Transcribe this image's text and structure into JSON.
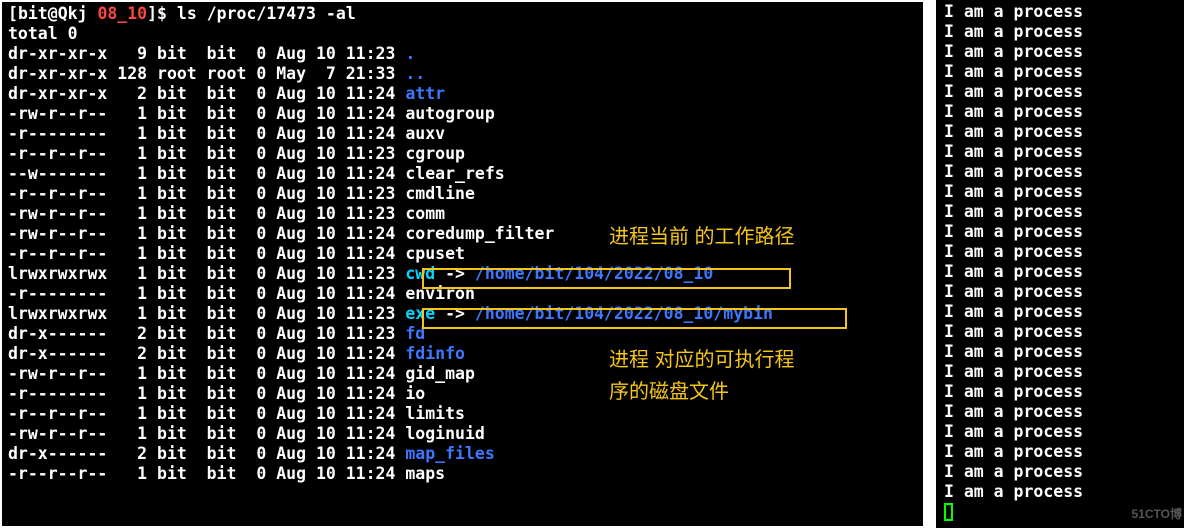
{
  "prompt": {
    "user": "bit",
    "host": "Qkj",
    "dir": "08_10",
    "cmd": "ls /proc/17473 -al"
  },
  "total": "total 0",
  "rows": [
    {
      "perm": "dr-xr-xr-x",
      "n": "9",
      "o": "bit",
      "g": "bit",
      "s": "0",
      "d": "Aug 10 11:23",
      "name": ".",
      "cls": "blue"
    },
    {
      "perm": "dr-xr-xr-x",
      "n": "128",
      "o": "root",
      "g": "root",
      "s": "0",
      "d": "May  7 21:33",
      "name": "..",
      "cls": "blue"
    },
    {
      "perm": "dr-xr-xr-x",
      "n": "2",
      "o": "bit",
      "g": "bit",
      "s": "0",
      "d": "Aug 10 11:24",
      "name": "attr",
      "cls": "blue"
    },
    {
      "perm": "-rw-r--r--",
      "n": "1",
      "o": "bit",
      "g": "bit",
      "s": "0",
      "d": "Aug 10 11:24",
      "name": "autogroup"
    },
    {
      "perm": "-r--------",
      "n": "1",
      "o": "bit",
      "g": "bit",
      "s": "0",
      "d": "Aug 10 11:24",
      "name": "auxv"
    },
    {
      "perm": "-r--r--r--",
      "n": "1",
      "o": "bit",
      "g": "bit",
      "s": "0",
      "d": "Aug 10 11:23",
      "name": "cgroup"
    },
    {
      "perm": "--w-------",
      "n": "1",
      "o": "bit",
      "g": "bit",
      "s": "0",
      "d": "Aug 10 11:24",
      "name": "clear_refs"
    },
    {
      "perm": "-r--r--r--",
      "n": "1",
      "o": "bit",
      "g": "bit",
      "s": "0",
      "d": "Aug 10 11:23",
      "name": "cmdline"
    },
    {
      "perm": "-rw-r--r--",
      "n": "1",
      "o": "bit",
      "g": "bit",
      "s": "0",
      "d": "Aug 10 11:23",
      "name": "comm"
    },
    {
      "perm": "-rw-r--r--",
      "n": "1",
      "o": "bit",
      "g": "bit",
      "s": "0",
      "d": "Aug 10 11:24",
      "name": "coredump_filter"
    },
    {
      "perm": "-r--r--r--",
      "n": "1",
      "o": "bit",
      "g": "bit",
      "s": "0",
      "d": "Aug 10 11:24",
      "name": "cpuset"
    },
    {
      "perm": "lrwxrwxrwx",
      "n": "1",
      "o": "bit",
      "g": "bit",
      "s": "0",
      "d": "Aug 10 11:23",
      "link": true,
      "name": "cwd",
      "target": "/home/bit/104/2022/08_10"
    },
    {
      "perm": "-r--------",
      "n": "1",
      "o": "bit",
      "g": "bit",
      "s": "0",
      "d": "Aug 10 11:24",
      "name": "environ"
    },
    {
      "perm": "lrwxrwxrwx",
      "n": "1",
      "o": "bit",
      "g": "bit",
      "s": "0",
      "d": "Aug 10 11:23",
      "link": true,
      "name": "exe",
      "target": "/home/bit/104/2022/08_10/mybin"
    },
    {
      "perm": "dr-x------",
      "n": "2",
      "o": "bit",
      "g": "bit",
      "s": "0",
      "d": "Aug 10 11:23",
      "name": "fd",
      "cls": "blue"
    },
    {
      "perm": "dr-x------",
      "n": "2",
      "o": "bit",
      "g": "bit",
      "s": "0",
      "d": "Aug 10 11:24",
      "name": "fdinfo",
      "cls": "blue"
    },
    {
      "perm": "-rw-r--r--",
      "n": "1",
      "o": "bit",
      "g": "bit",
      "s": "0",
      "d": "Aug 10 11:24",
      "name": "gid_map"
    },
    {
      "perm": "-r--------",
      "n": "1",
      "o": "bit",
      "g": "bit",
      "s": "0",
      "d": "Aug 10 11:24",
      "name": "io"
    },
    {
      "perm": "-r--r--r--",
      "n": "1",
      "o": "bit",
      "g": "bit",
      "s": "0",
      "d": "Aug 10 11:24",
      "name": "limits"
    },
    {
      "perm": "-rw-r--r--",
      "n": "1",
      "o": "bit",
      "g": "bit",
      "s": "0",
      "d": "Aug 10 11:24",
      "name": "loginuid"
    },
    {
      "perm": "dr-x------",
      "n": "2",
      "o": "bit",
      "g": "bit",
      "s": "0",
      "d": "Aug 10 11:24",
      "name": "map_files",
      "cls": "blue"
    },
    {
      "perm": "-r--r--r--",
      "n": "1",
      "o": "bit",
      "g": "bit",
      "s": "0",
      "d": "Aug 10 11:24",
      "name": "maps"
    }
  ],
  "ann1": "进程当前 的工作路径",
  "ann2a": "进程 对应的可执行程",
  "ann2b": "序的磁盘文件",
  "right_msg": "I am a process",
  "right_count": 25,
  "watermark": "51CTO博"
}
